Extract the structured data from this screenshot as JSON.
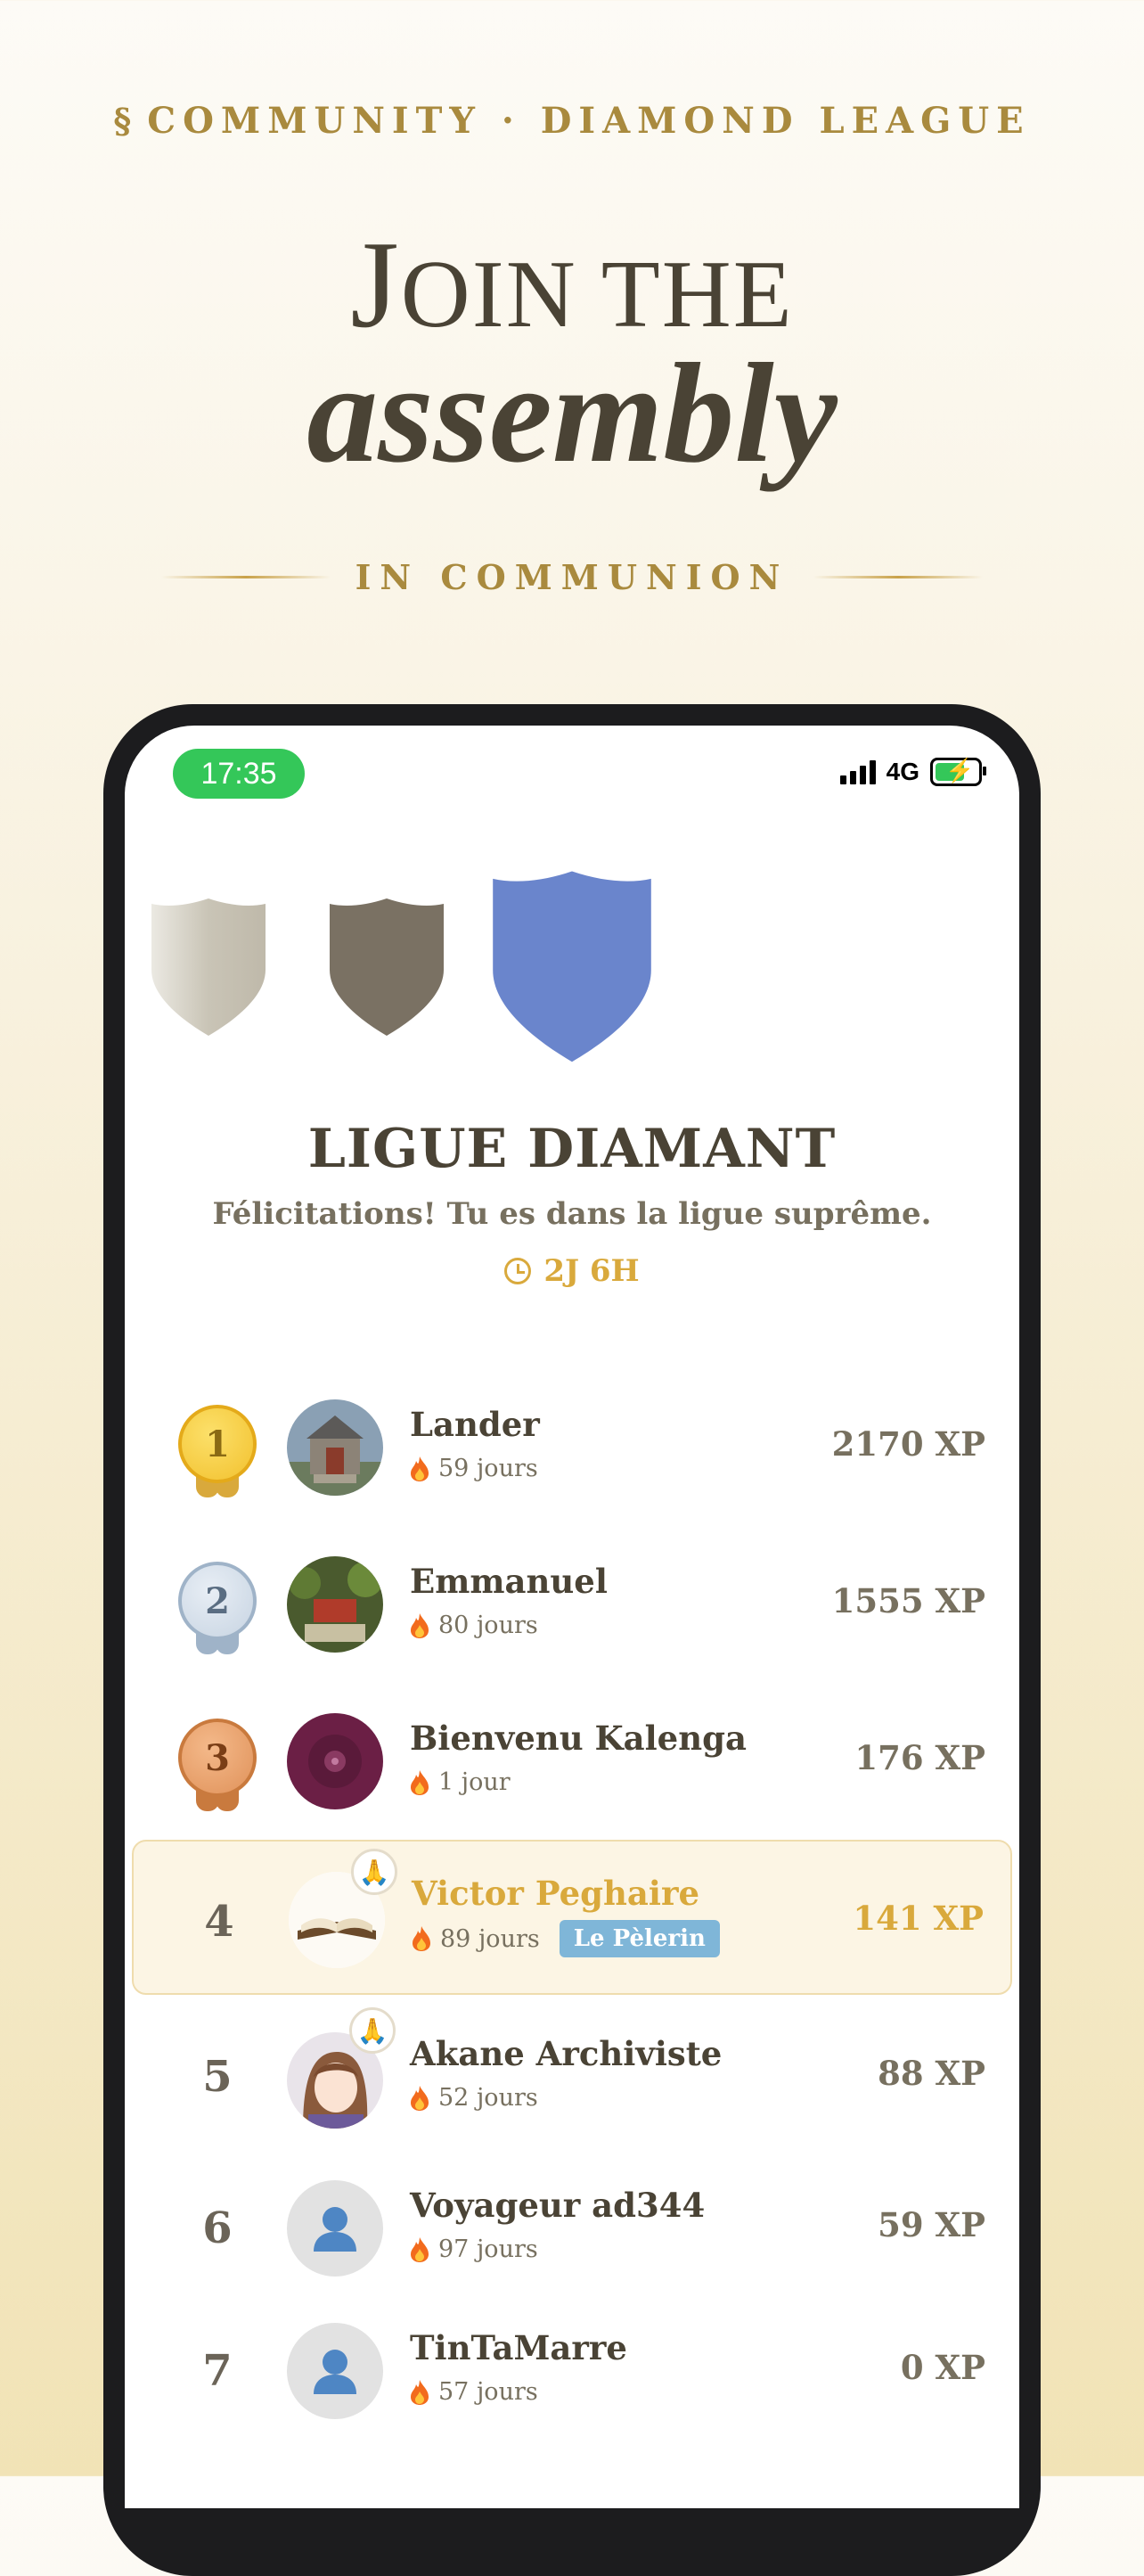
{
  "header": {
    "section_symbol": "§",
    "eyebrow": "COMMUNITY · DIAMOND LEAGUE",
    "title_j": "J",
    "title_rest": "OIN THE",
    "title_italic": "assembly",
    "divider_text": "IN COMMUNION"
  },
  "status_bar": {
    "time": "17:35",
    "network": "4G",
    "battery_bolt": "⚡"
  },
  "league": {
    "title": "LIGUE DIAMANT",
    "subtitle": "Félicitations! Tu es dans la ligue suprême.",
    "timer": "2J 6H",
    "shields": [
      {
        "name": "silver",
        "color": "#c9c4b6"
      },
      {
        "name": "bronze-dark",
        "color": "#7a7163"
      },
      {
        "name": "diamond",
        "color": "#6a85cc"
      }
    ]
  },
  "leaderboard": [
    {
      "rank": "1",
      "name": "Lander",
      "streak": "59 jours",
      "xp": "2170 XP",
      "medal": "gold",
      "avatar": "chapel"
    },
    {
      "rank": "2",
      "name": "Emmanuel",
      "streak": "80 jours",
      "xp": "1555 XP",
      "medal": "silver",
      "avatar": "garden"
    },
    {
      "rank": "3",
      "name": "Bienvenu Kalenga",
      "streak": "1 jour",
      "xp": "176 XP",
      "medal": "bronze",
      "avatar": "vinyl"
    },
    {
      "rank": "4",
      "name": "Victor Peghaire",
      "streak": "89 jours",
      "xp": "141 XP",
      "tag": "Le Pèlerin",
      "highlight": true,
      "badge": "🙏",
      "avatar": "book"
    },
    {
      "rank": "5",
      "name": "Akane Archiviste",
      "streak": "52 jours",
      "xp": "88 XP",
      "badge": "🙏",
      "avatar": "anime-girl"
    },
    {
      "rank": "6",
      "name": "Voyageur ad344",
      "streak": "97 jours",
      "xp": "59 XP",
      "avatar": "default-user"
    },
    {
      "rank": "7",
      "name": "TinTaMarre",
      "streak": "57 jours",
      "xp": "0 XP",
      "avatar": "default-user"
    }
  ]
}
